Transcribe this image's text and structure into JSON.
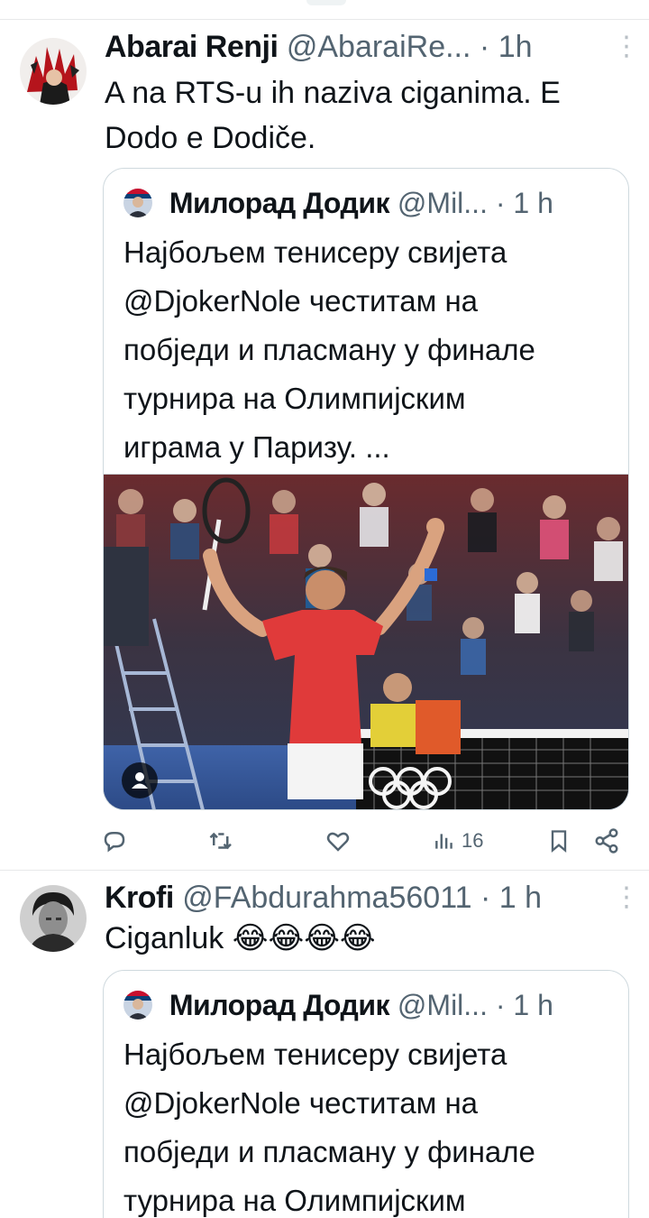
{
  "colors": {
    "text": "#0f1419",
    "muted": "#536471",
    "border": "#cfd9de",
    "accent": "#1d9bf0"
  },
  "tweets": [
    {
      "name": "Abarai Renji",
      "handle": "@AbaraiRe...",
      "dot": "·",
      "time": "1h",
      "text": "A na RTS-u ih naziva ciganima. E Dodo e Dodiče.",
      "quote": {
        "name": "Милорад Додик",
        "handle": "@Mil...",
        "dot": "·",
        "time": "1 h",
        "lines": [
          "Најбољем тенисеру свијета",
          "@DjokerNole честитам на",
          "побједи и пласману у финале",
          "турнира на Олимпијским",
          "играма у Паризу. ..."
        ]
      },
      "metrics": {
        "views": "16"
      },
      "icons": [
        "reply-icon",
        "retweet-icon",
        "like-icon",
        "views-icon",
        "bookmark-icon",
        "share-icon"
      ]
    },
    {
      "name": "Krofi",
      "handle": "@FAbdurahma56011",
      "dot": "·",
      "time": "1 h",
      "text": "Ciganluk 😂😂😂😂",
      "quote": {
        "name": "Милорад Додик",
        "handle": "@Mil...",
        "dot": "·",
        "time": "1 h",
        "lines": [
          "Најбољем тенисеру свијета",
          "@DjokerNole честитам на",
          "побједи и пласману у финале",
          "турнира на Олимпијским"
        ]
      }
    }
  ]
}
